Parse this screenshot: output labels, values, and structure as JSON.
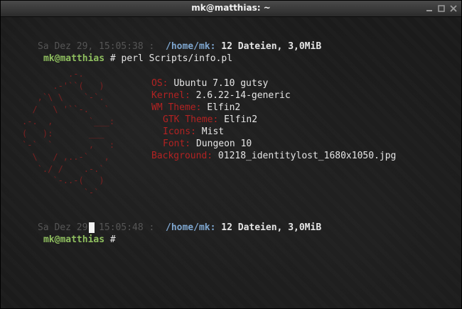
{
  "window": {
    "title": "mk@matthias: ~"
  },
  "prompt1": {
    "datetime": "Sa Dez 29, 15:05:38 :",
    "path": "/home/mk:",
    "files": "12 Dateien, 3,0MiB",
    "user": "mk@matthias",
    "symbol": "#",
    "command": "perl Scripts/info.pl"
  },
  "ascii_logo": "         .-.\n      .-'``(   )\n   ,`\\ \\    `-`.\n  /   \\ '``-.   `\n.-.  ,       `___:\n(   ):       ___\n`-`  `       ,   :\n  \\   / ,..-`   ,\n   `./ /    .-.`\n      `-..-(   )\n            `-`",
  "info": [
    {
      "label": "OS:",
      "value": "Ubuntu 7.10 gutsy"
    },
    {
      "label": "Kernel:",
      "value": "2.6.22-14-generic"
    },
    {
      "label": "WM Theme:",
      "value": "Elfin2"
    },
    {
      "label": "GTK Theme:",
      "value": "Elfin2"
    },
    {
      "label": "Icons:",
      "value": "Mist"
    },
    {
      "label": "Font:",
      "value": "Dungeon 10"
    },
    {
      "label": "Background:",
      "value": "01218_identitylost_1680x1050.jpg"
    }
  ],
  "prompt2": {
    "datetime": "Sa Dez 29, 15:05:48 :",
    "path": "/home/mk:",
    "files": "12 Dateien, 3,0MiB",
    "user": "mk@matthias",
    "symbol": "#"
  }
}
